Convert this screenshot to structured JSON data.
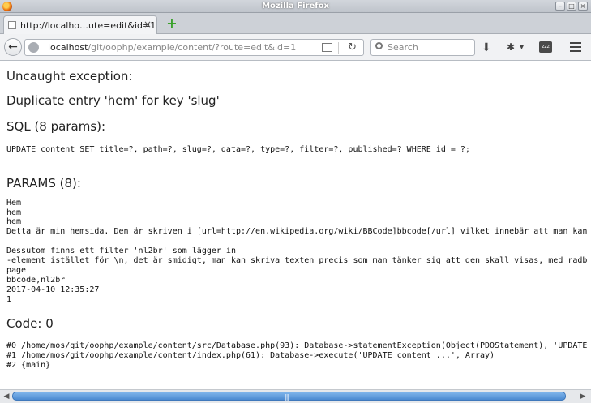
{
  "window": {
    "title": "Mozilla Firefox"
  },
  "tab": {
    "label": "http://localho…ute=edit&id=1",
    "close": "×"
  },
  "nav": {
    "url_host": "localhost",
    "url_path": "/git/oophp/example/content/?route=edit&id=1",
    "search_placeholder": "Search"
  },
  "page": {
    "heading_exception": "Uncaught exception:",
    "message": "Duplicate entry 'hem' for key 'slug'",
    "heading_sql": "SQL (8 params):",
    "sql": "UPDATE content SET title=?, path=?, slug=?, data=?, type=?, filter=?, published=? WHERE id = ?;",
    "heading_params": "PARAMS (8):",
    "params": [
      "Hem",
      "hem",
      "hem",
      "Detta är min hemsida. Den är skriven i [url=http://en.wikipedia.org/wiki/BBCode]bbcode[/url] vilket innebär att man kan",
      "",
      "Dessutom finns ett filter 'nl2br' som lägger in",
      "-element istället för \\n, det är smidigt, man kan skriva texten precis som man tänker sig att den skall visas, med radb",
      "page",
      "bbcode,nl2br",
      "2017-04-10 12:35:27",
      "1"
    ],
    "heading_code": "Code: 0",
    "trace": [
      "#0 /home/mos/git/oophp/example/content/src/Database.php(93): Database->statementException(Object(PDOStatement), 'UPDATE",
      "#1 /home/mos/git/oophp/example/content/index.php(61): Database->execute('UPDATE content ...', Array)",
      "#2 {main}"
    ]
  }
}
